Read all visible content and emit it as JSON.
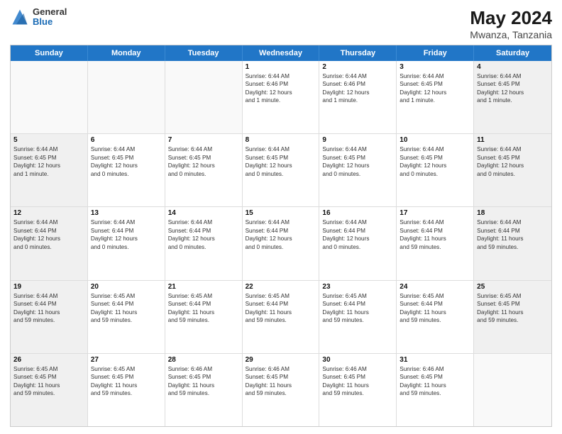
{
  "header": {
    "logo_general": "General",
    "logo_blue": "Blue",
    "title": "May 2024",
    "location": "Mwanza, Tanzania"
  },
  "days_of_week": [
    "Sunday",
    "Monday",
    "Tuesday",
    "Wednesday",
    "Thursday",
    "Friday",
    "Saturday"
  ],
  "weeks": [
    [
      {
        "day": "",
        "info": "",
        "empty": true
      },
      {
        "day": "",
        "info": "",
        "empty": true
      },
      {
        "day": "",
        "info": "",
        "empty": true
      },
      {
        "day": "1",
        "info": "Sunrise: 6:44 AM\nSunset: 6:46 PM\nDaylight: 12 hours\nand 1 minute."
      },
      {
        "day": "2",
        "info": "Sunrise: 6:44 AM\nSunset: 6:46 PM\nDaylight: 12 hours\nand 1 minute."
      },
      {
        "day": "3",
        "info": "Sunrise: 6:44 AM\nSunset: 6:45 PM\nDaylight: 12 hours\nand 1 minute."
      },
      {
        "day": "4",
        "info": "Sunrise: 6:44 AM\nSunset: 6:45 PM\nDaylight: 12 hours\nand 1 minute."
      }
    ],
    [
      {
        "day": "5",
        "info": "Sunrise: 6:44 AM\nSunset: 6:45 PM\nDaylight: 12 hours\nand 1 minute."
      },
      {
        "day": "6",
        "info": "Sunrise: 6:44 AM\nSunset: 6:45 PM\nDaylight: 12 hours\nand 0 minutes."
      },
      {
        "day": "7",
        "info": "Sunrise: 6:44 AM\nSunset: 6:45 PM\nDaylight: 12 hours\nand 0 minutes."
      },
      {
        "day": "8",
        "info": "Sunrise: 6:44 AM\nSunset: 6:45 PM\nDaylight: 12 hours\nand 0 minutes."
      },
      {
        "day": "9",
        "info": "Sunrise: 6:44 AM\nSunset: 6:45 PM\nDaylight: 12 hours\nand 0 minutes."
      },
      {
        "day": "10",
        "info": "Sunrise: 6:44 AM\nSunset: 6:45 PM\nDaylight: 12 hours\nand 0 minutes."
      },
      {
        "day": "11",
        "info": "Sunrise: 6:44 AM\nSunset: 6:45 PM\nDaylight: 12 hours\nand 0 minutes."
      }
    ],
    [
      {
        "day": "12",
        "info": "Sunrise: 6:44 AM\nSunset: 6:44 PM\nDaylight: 12 hours\nand 0 minutes."
      },
      {
        "day": "13",
        "info": "Sunrise: 6:44 AM\nSunset: 6:44 PM\nDaylight: 12 hours\nand 0 minutes."
      },
      {
        "day": "14",
        "info": "Sunrise: 6:44 AM\nSunset: 6:44 PM\nDaylight: 12 hours\nand 0 minutes."
      },
      {
        "day": "15",
        "info": "Sunrise: 6:44 AM\nSunset: 6:44 PM\nDaylight: 12 hours\nand 0 minutes."
      },
      {
        "day": "16",
        "info": "Sunrise: 6:44 AM\nSunset: 6:44 PM\nDaylight: 12 hours\nand 0 minutes."
      },
      {
        "day": "17",
        "info": "Sunrise: 6:44 AM\nSunset: 6:44 PM\nDaylight: 11 hours\nand 59 minutes."
      },
      {
        "day": "18",
        "info": "Sunrise: 6:44 AM\nSunset: 6:44 PM\nDaylight: 11 hours\nand 59 minutes."
      }
    ],
    [
      {
        "day": "19",
        "info": "Sunrise: 6:44 AM\nSunset: 6:44 PM\nDaylight: 11 hours\nand 59 minutes."
      },
      {
        "day": "20",
        "info": "Sunrise: 6:45 AM\nSunset: 6:44 PM\nDaylight: 11 hours\nand 59 minutes."
      },
      {
        "day": "21",
        "info": "Sunrise: 6:45 AM\nSunset: 6:44 PM\nDaylight: 11 hours\nand 59 minutes."
      },
      {
        "day": "22",
        "info": "Sunrise: 6:45 AM\nSunset: 6:44 PM\nDaylight: 11 hours\nand 59 minutes."
      },
      {
        "day": "23",
        "info": "Sunrise: 6:45 AM\nSunset: 6:44 PM\nDaylight: 11 hours\nand 59 minutes."
      },
      {
        "day": "24",
        "info": "Sunrise: 6:45 AM\nSunset: 6:44 PM\nDaylight: 11 hours\nand 59 minutes."
      },
      {
        "day": "25",
        "info": "Sunrise: 6:45 AM\nSunset: 6:45 PM\nDaylight: 11 hours\nand 59 minutes."
      }
    ],
    [
      {
        "day": "26",
        "info": "Sunrise: 6:45 AM\nSunset: 6:45 PM\nDaylight: 11 hours\nand 59 minutes."
      },
      {
        "day": "27",
        "info": "Sunrise: 6:45 AM\nSunset: 6:45 PM\nDaylight: 11 hours\nand 59 minutes."
      },
      {
        "day": "28",
        "info": "Sunrise: 6:46 AM\nSunset: 6:45 PM\nDaylight: 11 hours\nand 59 minutes."
      },
      {
        "day": "29",
        "info": "Sunrise: 6:46 AM\nSunset: 6:45 PM\nDaylight: 11 hours\nand 59 minutes."
      },
      {
        "day": "30",
        "info": "Sunrise: 6:46 AM\nSunset: 6:45 PM\nDaylight: 11 hours\nand 59 minutes."
      },
      {
        "day": "31",
        "info": "Sunrise: 6:46 AM\nSunset: 6:45 PM\nDaylight: 11 hours\nand 59 minutes."
      },
      {
        "day": "",
        "info": "",
        "empty": true
      }
    ]
  ]
}
